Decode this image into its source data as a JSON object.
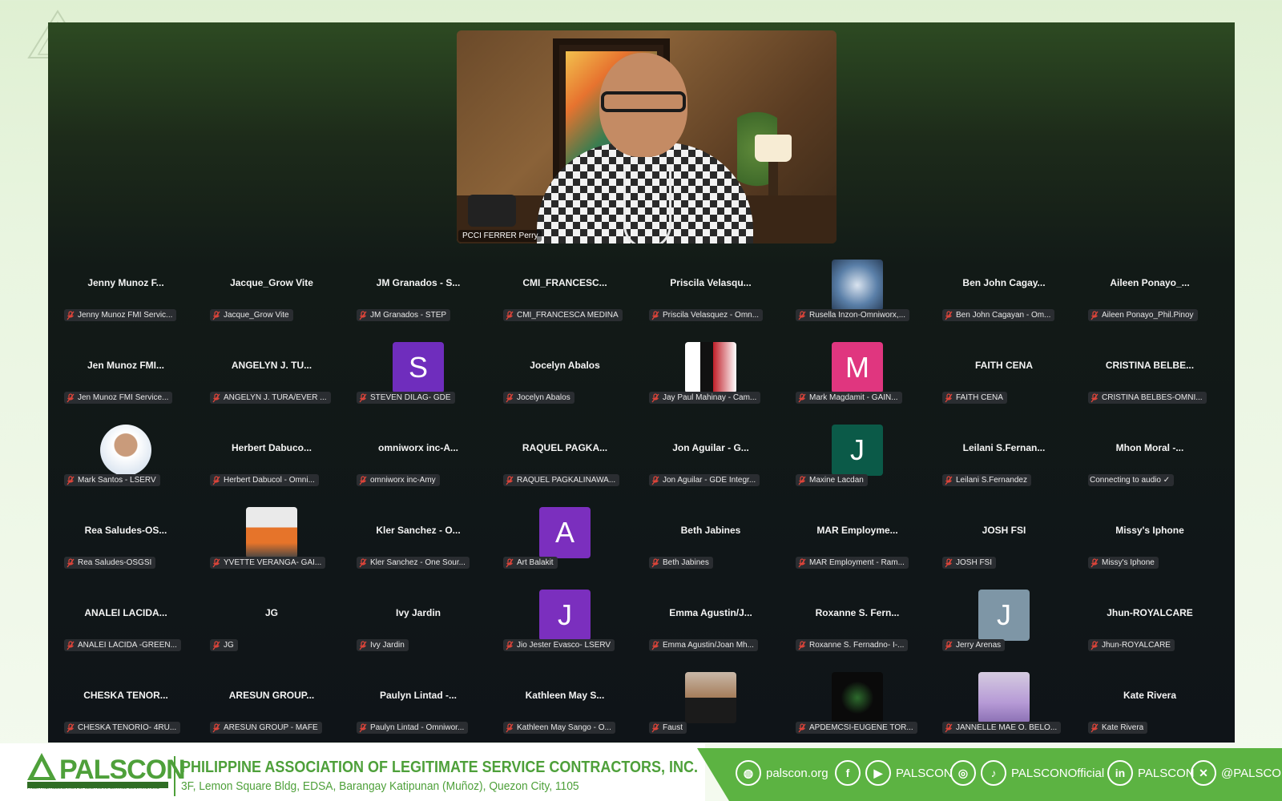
{
  "speaker": {
    "name": "PCCI FERRER Perry"
  },
  "participants": [
    {
      "big": "Jenny Munoz F...",
      "label": "Jenny Munoz FMI Servic..."
    },
    {
      "big": "Jacque_Grow Vite",
      "label": "Jacque_Grow Vite"
    },
    {
      "big": "JM Granados - S...",
      "label": "JM Granados - STEP"
    },
    {
      "big": "CMI_FRANCESC...",
      "label": "CMI_FRANCESCA MEDINA"
    },
    {
      "big": "Priscila Velasqu...",
      "label": "Priscila Velasquez - Omn..."
    },
    {
      "avatar": "badge",
      "label": "Rusella Inzon-Omniworx,..."
    },
    {
      "big": "Ben John Cagay...",
      "label": "Ben John Cagayan - Om..."
    },
    {
      "big": "Aileen Ponayo_...",
      "label": "Aileen Ponayo_Phil.Pinoy"
    },
    {
      "big": "Jen Munoz FMI...",
      "label": "Jen Munoz FMI Service..."
    },
    {
      "big": "ANGELYN J. TU...",
      "label": "ANGELYN J. TURA/EVER ..."
    },
    {
      "avatar": "S",
      "color": "#6f2dbd",
      "label": "STEVEN DILAG- GDE"
    },
    {
      "big": "Jocelyn Abalos",
      "label": "Jocelyn Abalos"
    },
    {
      "avatar": "campaign",
      "label": "Jay Paul Mahinay - Cam..."
    },
    {
      "avatar": "M",
      "color": "#e0367f",
      "label": "Mark Magdamit - GAIN..."
    },
    {
      "big": "FAITH CENA",
      "label": "FAITH CENA"
    },
    {
      "big": "CRISTINA BELBE...",
      "label": "CRISTINA BELBES-OMNI..."
    },
    {
      "avatar": "photo-round",
      "label": "Mark Santos - LSERV"
    },
    {
      "big": "Herbert Dabuco...",
      "label": "Herbert Dabucol - Omni..."
    },
    {
      "big": "omniworx inc-A...",
      "label": "omniworx inc-Amy"
    },
    {
      "big": "RAQUEL PAGKA...",
      "label": "RAQUEL PAGKALINAWA..."
    },
    {
      "big": "Jon Aguilar - G...",
      "label": "Jon Aguilar - GDE Integr..."
    },
    {
      "avatar": "J",
      "color": "#0b5a48",
      "label": "Maxine Lacdan"
    },
    {
      "big": "Leilani S.Fernan...",
      "label": "Leilani S.Fernandez"
    },
    {
      "big": "Mhon Moral -...",
      "label": "Connecting to audio ✓",
      "nomic": true
    },
    {
      "big": "Rea Saludes-OS...",
      "label": "Rea Saludes-OSGSI"
    },
    {
      "avatar": "photo-chairs",
      "label": "YVETTE VERANGA- GAI..."
    },
    {
      "big": "Kler Sanchez - O...",
      "label": "Kler Sanchez - One Sour..."
    },
    {
      "avatar": "A",
      "color": "#7b2fbe",
      "label": "Art Balakit"
    },
    {
      "big": "Beth Jabines",
      "label": "Beth Jabines"
    },
    {
      "big": "MAR Employme...",
      "label": "MAR Employment - Ram..."
    },
    {
      "big": "JOSH FSI",
      "label": "JOSH FSI"
    },
    {
      "big": "Missy's Iphone",
      "label": "Missy's Iphone"
    },
    {
      "big": "ANALEI LACIDA...",
      "label": "ANALEI LACIDA -GREEN..."
    },
    {
      "big": "JG",
      "label": "JG"
    },
    {
      "big": "Ivy Jardin",
      "label": "Ivy Jardin"
    },
    {
      "avatar": "J",
      "color": "#7b2fbe",
      "label": "Jio Jester Evasco- LSERV"
    },
    {
      "big": "Emma Agustin/J...",
      "label": "Emma Agustin/Joan Mh..."
    },
    {
      "big": "Roxanne S. Fern...",
      "label": "Roxanne S. Fernadno- I-..."
    },
    {
      "avatar": "J",
      "color": "#7e96a6",
      "label": "Jerry Arenas"
    },
    {
      "big": "Jhun-ROYALCARE",
      "label": "Jhun-ROYALCARE"
    },
    {
      "big": "CHESKA TENOR...",
      "label": "CHESKA TENORIO- 4RU..."
    },
    {
      "big": "ARESUN GROUP...",
      "label": "ARESUN GROUP - MAFE"
    },
    {
      "big": "Paulyn Lintad -...",
      "label": "Paulyn Lintad - Omniwor..."
    },
    {
      "big": "Kathleen May S...",
      "label": "Kathleen May Sango - O..."
    },
    {
      "avatar": "photo-man",
      "label": "Faust"
    },
    {
      "avatar": "photo-dark",
      "label": "APDEMCSI-EUGENE TOR..."
    },
    {
      "avatar": "photo-woman",
      "label": "JANNELLE MAE O. BELO..."
    },
    {
      "big": "Kate Rivera",
      "label": "Kate Rivera"
    }
  ],
  "footer": {
    "logo": "PALSCON",
    "logo_sub": "PHILIPPINE ASSOCIATION OF LEGITIMATE SERVICE CONTRACTORS",
    "org_name": "PHILIPPINE ASSOCIATION OF LEGITIMATE SERVICE CONTRACTORS, INC.",
    "address": "3F, Lemon Square Bldg, EDSA, Barangay Katipunan (Muñoz), Quezon City, 1105",
    "website": "palscon.org",
    "fb_yt": "PALSCON",
    "ig_tt": "PALSCONOfficial",
    "linkedin": "PALSCON",
    "x": "@PALSCONI"
  },
  "colors": {
    "brand_green": "#4ea03a",
    "footer_bar": "#5cb342",
    "muted_mic": "#e0453a"
  }
}
